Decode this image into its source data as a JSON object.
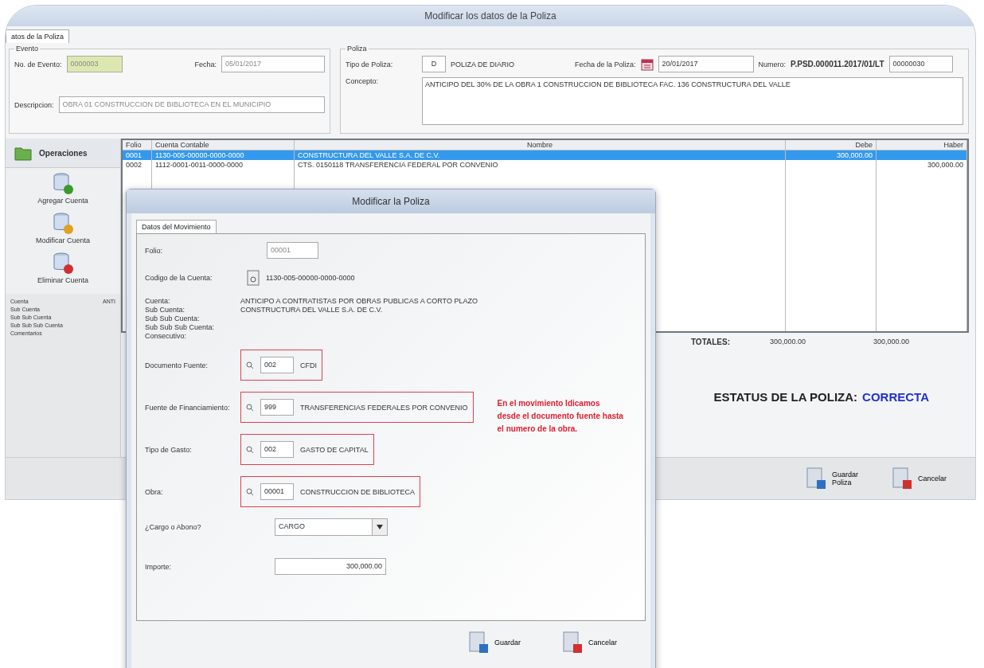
{
  "window": {
    "title": "Modificar los datos de la Poliza"
  },
  "tabs": [
    {
      "label": "atos de la Poliza",
      "selected": true
    }
  ],
  "evento": {
    "legend": "Evento",
    "no_label": "No. de Evento:",
    "no_value": "0000003",
    "fecha_label": "Fecha:",
    "fecha_value": "05/01/2017",
    "desc_label": "Descripcion:",
    "desc_value": "OBRA 01 CONSTRUCCION DE BIBLIOTECA EN EL MUNICIPIO"
  },
  "poliza": {
    "legend": "Poliza",
    "tipo_label": "Tipo de Poliza:",
    "tipo_code": "D",
    "tipo_name": "POLIZA DE DIARIO",
    "fecha_label": "Fecha de la Poliza:",
    "fecha_value": "20/01/2017",
    "numero_label": "Numero:",
    "numero_value": "P.PSD.000011.2017/01/LT",
    "numero_box": "00000030",
    "concepto_label": "Concepto:",
    "concepto_value": "ANTICIPO DEL 30% DE LA OBRA 1 CONSTRUCCION DE BIBLIOTECA FAC. 136 CONSTRUCTURA DEL VALLE"
  },
  "sidebar": {
    "header": "Operaciones",
    "items": [
      {
        "label": "Agregar Cuenta",
        "kind": "add"
      },
      {
        "label": "Modificar Cuenta",
        "kind": "edit"
      },
      {
        "label": "Eliminar Cuenta",
        "kind": "delete"
      }
    ],
    "info": [
      {
        "label": "Cuenta",
        "value": "ANTI"
      },
      {
        "label": "Sub Cuenta"
      },
      {
        "label": "Sub Sub Cuenta"
      },
      {
        "label": "Sub Sub Sub Cuenta"
      },
      {
        "label": "Comentarios"
      }
    ]
  },
  "table": {
    "columns": [
      "Folio",
      "Cuenta Contable",
      "Nombre",
      "Debe",
      "Haber"
    ],
    "rows": [
      {
        "selected": true,
        "cells": [
          "0001",
          "1130-005-00000-0000-0000",
          "CONSTRUCTURA DEL VALLE S.A. DE C.V.",
          "300,000.00",
          null
        ]
      },
      {
        "selected": false,
        "cells": [
          "0002",
          "1112-0001-0011-0000-0000",
          "CTS. 0150118 TRANSFERENCIA FEDERAL POR CONVENIO",
          null,
          "300,000.00"
        ]
      }
    ],
    "totals_label": "TOTALES:",
    "total_debe": "300,000.00",
    "total_haber": "300,000.00"
  },
  "status": {
    "label": "ESTATUS DE LA POLIZA:",
    "value": "CORRECTA"
  },
  "buttons": [
    {
      "label": "Guardar Poliza",
      "kind": "save"
    },
    {
      "label": "Cancelar",
      "kind": "cancel"
    }
  ],
  "dialog": {
    "title": "Modificar la Poliza",
    "tab": {
      "label": "Datos del Movimiento",
      "selected": true
    },
    "folio_label": "Folio:",
    "folio_value": "00001",
    "codigo_label": "Codigo de la Cuenta:",
    "codigo_value": "1130-005-00000-0000-0000",
    "details": [
      {
        "label": "Cuenta:",
        "value": "ANTICIPO A CONTRATISTAS POR OBRAS PUBLICAS A CORTO PLAZO"
      },
      {
        "label": "Sub Cuenta:",
        "value": "CONSTRUCTURA DEL VALLE S.A. DE C.V."
      },
      {
        "label": "Sub Sub Cuenta:"
      },
      {
        "label": "Sub Sub Sub Cuenta:"
      },
      {
        "label": "Consecutivo:"
      }
    ],
    "lookups": [
      {
        "label": "Documento Fuente:",
        "code": "002",
        "name": "CFDI"
      },
      {
        "label": "Fuente de Financiamiento:",
        "code": "999",
        "name": "TRANSFERENCIAS FEDERALES POR CONVENIO"
      },
      {
        "label": "Tipo de Gasto:",
        "code": "002",
        "name": "GASTO DE CAPITAL"
      },
      {
        "label": "Obra:",
        "code": "00001",
        "name": "CONSTRUCCION DE BIBLIOTECA"
      }
    ],
    "note": "En el movimiento Idicamos desde el documento fuente hasta el numero de la obra.",
    "cargo_label": "¿Cargo o Abono?",
    "cargo_value": "CARGO",
    "importe_label": "Importe:",
    "importe_value": "300,000.00",
    "buttons": [
      {
        "label": "Guardar",
        "kind": "save"
      },
      {
        "label": "Cancelar",
        "kind": "cancel"
      }
    ]
  }
}
